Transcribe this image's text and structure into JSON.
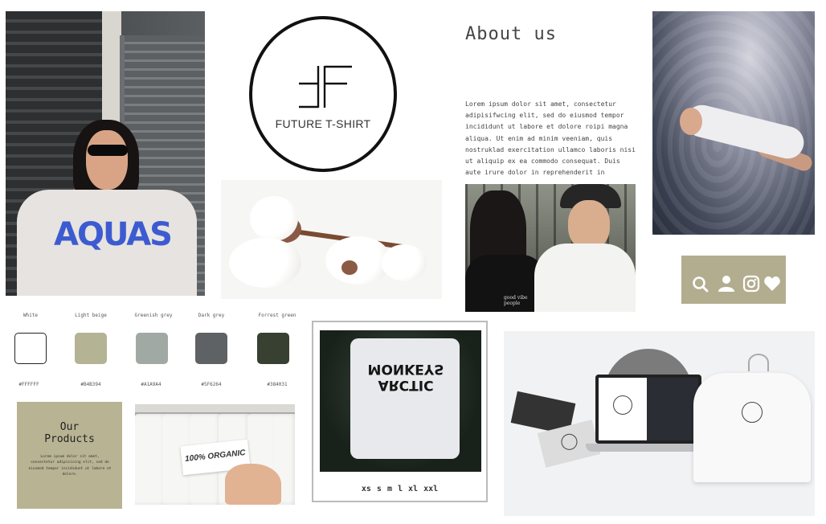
{
  "logo": {
    "brand_name": "FUTURE T-SHIRT",
    "mark": "FF monogram"
  },
  "about": {
    "title": "About us",
    "body": "Lorem ipsum dolor sit amet, consectetur adipisifwcing elit, sed do eiusmod tempor incididunt ut labore et dolore roipi magna aliqua. Ut enim ad minim veeniam, quis nostruklad exercitation ullamco laboris nisi ut aliquip ex ea commodo consequat. Duis aute irure dolor in reprehenderit in"
  },
  "girl_photo": {
    "shirt_print": "AQUAS"
  },
  "couple_photo": {
    "shirt_print": "good vibe people"
  },
  "icons": [
    "search-icon",
    "user-icon",
    "instagram-icon",
    "heart-icon"
  ],
  "palette": [
    {
      "name": "White",
      "hex": "#FFFFFF",
      "color": "#FFFFFF"
    },
    {
      "name": "Light beige",
      "hex": "#B4B394",
      "color": "#B4B394"
    },
    {
      "name": "Greenish grey",
      "hex": "#A1A9A4",
      "color": "#A1A9A4"
    },
    {
      "name": "Dark grey",
      "hex": "#5F6264",
      "color": "#5F6264"
    },
    {
      "name": "Forrest green",
      "hex": "#384031",
      "color": "#384031"
    }
  ],
  "products": {
    "title_line1": "Our",
    "title_line2": "Products",
    "body": "Lorem ipsum dolor sit amet, consectetur adipisicing elit, sed do eiusmod tempor incididunt ut labore et dolore."
  },
  "organic_tag": "100% ORGANIC",
  "polaroid": {
    "shirt_print": "ARCTIC MONKEYS",
    "sizes": "xs s m l xl xxl"
  }
}
